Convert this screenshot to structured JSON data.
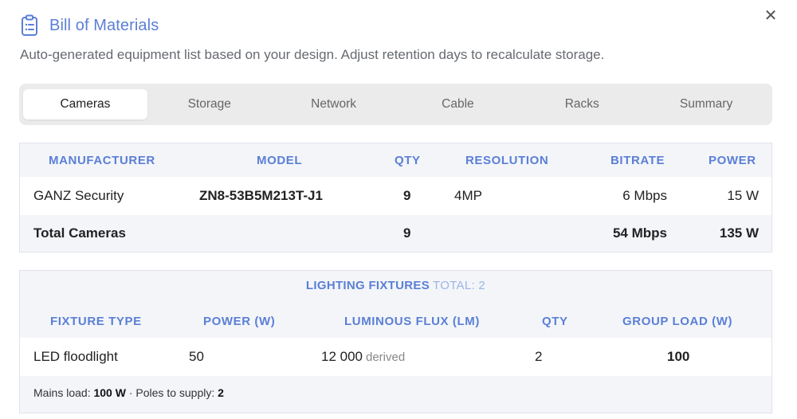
{
  "header": {
    "title": "Bill of Materials",
    "subtitle": "Auto-generated equipment list based on your design. Adjust retention days to recalculate storage.",
    "close_glyph": "✕"
  },
  "tabs": [
    {
      "label": "Cameras",
      "active": true
    },
    {
      "label": "Storage",
      "active": false
    },
    {
      "label": "Network",
      "active": false
    },
    {
      "label": "Cable",
      "active": false
    },
    {
      "label": "Racks",
      "active": false
    },
    {
      "label": "Summary",
      "active": false
    }
  ],
  "cameras": {
    "columns": [
      "MANUFACTURER",
      "MODEL",
      "QTY",
      "RESOLUTION",
      "BITRATE",
      "POWER"
    ],
    "rows": [
      {
        "manufacturer": "GANZ Security",
        "model": "ZN8-53B5M213T-J1",
        "qty": "9",
        "resolution": "4MP",
        "bitrate": "6 Mbps",
        "power": "15 W"
      }
    ],
    "total": {
      "label": "Total Cameras",
      "qty": "9",
      "bitrate": "54 Mbps",
      "power": "135 W"
    }
  },
  "lighting": {
    "title": "LIGHTING FIXTURES",
    "total_label": "TOTAL: 2",
    "columns": [
      "FIXTURE TYPE",
      "POWER (W)",
      "LUMINOUS FLUX (LM)",
      "QTY",
      "GROUP LOAD (W)"
    ],
    "rows": [
      {
        "type": "LED floodlight",
        "power": "50",
        "flux": "12 000",
        "flux_note": "derived",
        "qty": "2",
        "group_load": "100"
      }
    ],
    "footer": {
      "mains_label": "Mains load:",
      "mains_value": "100 W",
      "sep": "·",
      "poles_label": "Poles to supply:",
      "poles_value": "2"
    }
  },
  "colors": {
    "accent": "#5b7fd6",
    "accent_light": "#9db4e6",
    "panel_bg": "#f3f5f9",
    "tabs_bg": "#ebebeb"
  },
  "icons": {
    "title_icon": "clipboard-list-icon",
    "close_icon": "close-icon"
  }
}
